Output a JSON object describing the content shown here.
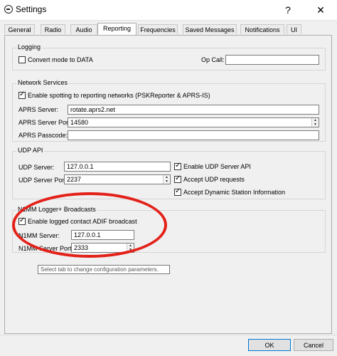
{
  "window": {
    "title": "Settings",
    "help": "?",
    "close": "✕"
  },
  "tabs": [
    {
      "label": "General"
    },
    {
      "label": "Radio"
    },
    {
      "label": "Audio"
    },
    {
      "label": "Reporting"
    },
    {
      "label": "Frequencies"
    },
    {
      "label": "Saved Messages"
    },
    {
      "label": "Notifications"
    },
    {
      "label": "UI"
    }
  ],
  "logging": {
    "title": "Logging",
    "convert_label": "Convert mode to DATA",
    "convert_checked": false,
    "opcall_label": "Op Call:",
    "opcall_value": ""
  },
  "network": {
    "title": "Network Services",
    "enable_label": "Enable spotting to reporting networks (PSKReporter & APRS-IS)",
    "enable_checked": true,
    "aprs_server_label": "APRS Server:",
    "aprs_server_value": "rotate.aprs2.net",
    "aprs_port_label": "APRS Server Port:",
    "aprs_port_value": "14580",
    "aprs_passcode_label": "APRS Passcode:",
    "aprs_passcode_value": ""
  },
  "udp": {
    "title": "UDP API",
    "server_label": "UDP Server:",
    "server_value": "127.0.0.1",
    "port_label": "UDP Server Port:",
    "port_value": "2237",
    "enable_api_label": "Enable UDP Server API",
    "accept_requests_label": "Accept UDP requests",
    "accept_dynamic_label": "Accept Dynamic Station Information"
  },
  "n1mm": {
    "title": "N1MM Logger+ Broadcasts",
    "enable_label": "Enable logged contact ADIF broadcast",
    "server_label": "N1MM Server:",
    "server_value": "127.0.0.1",
    "port_label": "N1MM Server Port:",
    "port_value": "2333"
  },
  "tooltip": "Select tab to change configuration parameters.",
  "buttons": {
    "ok": "OK",
    "cancel": "Cancel"
  },
  "colors": {
    "highlight_ellipse": "#e32119",
    "default_button_border": "#0078d7"
  }
}
